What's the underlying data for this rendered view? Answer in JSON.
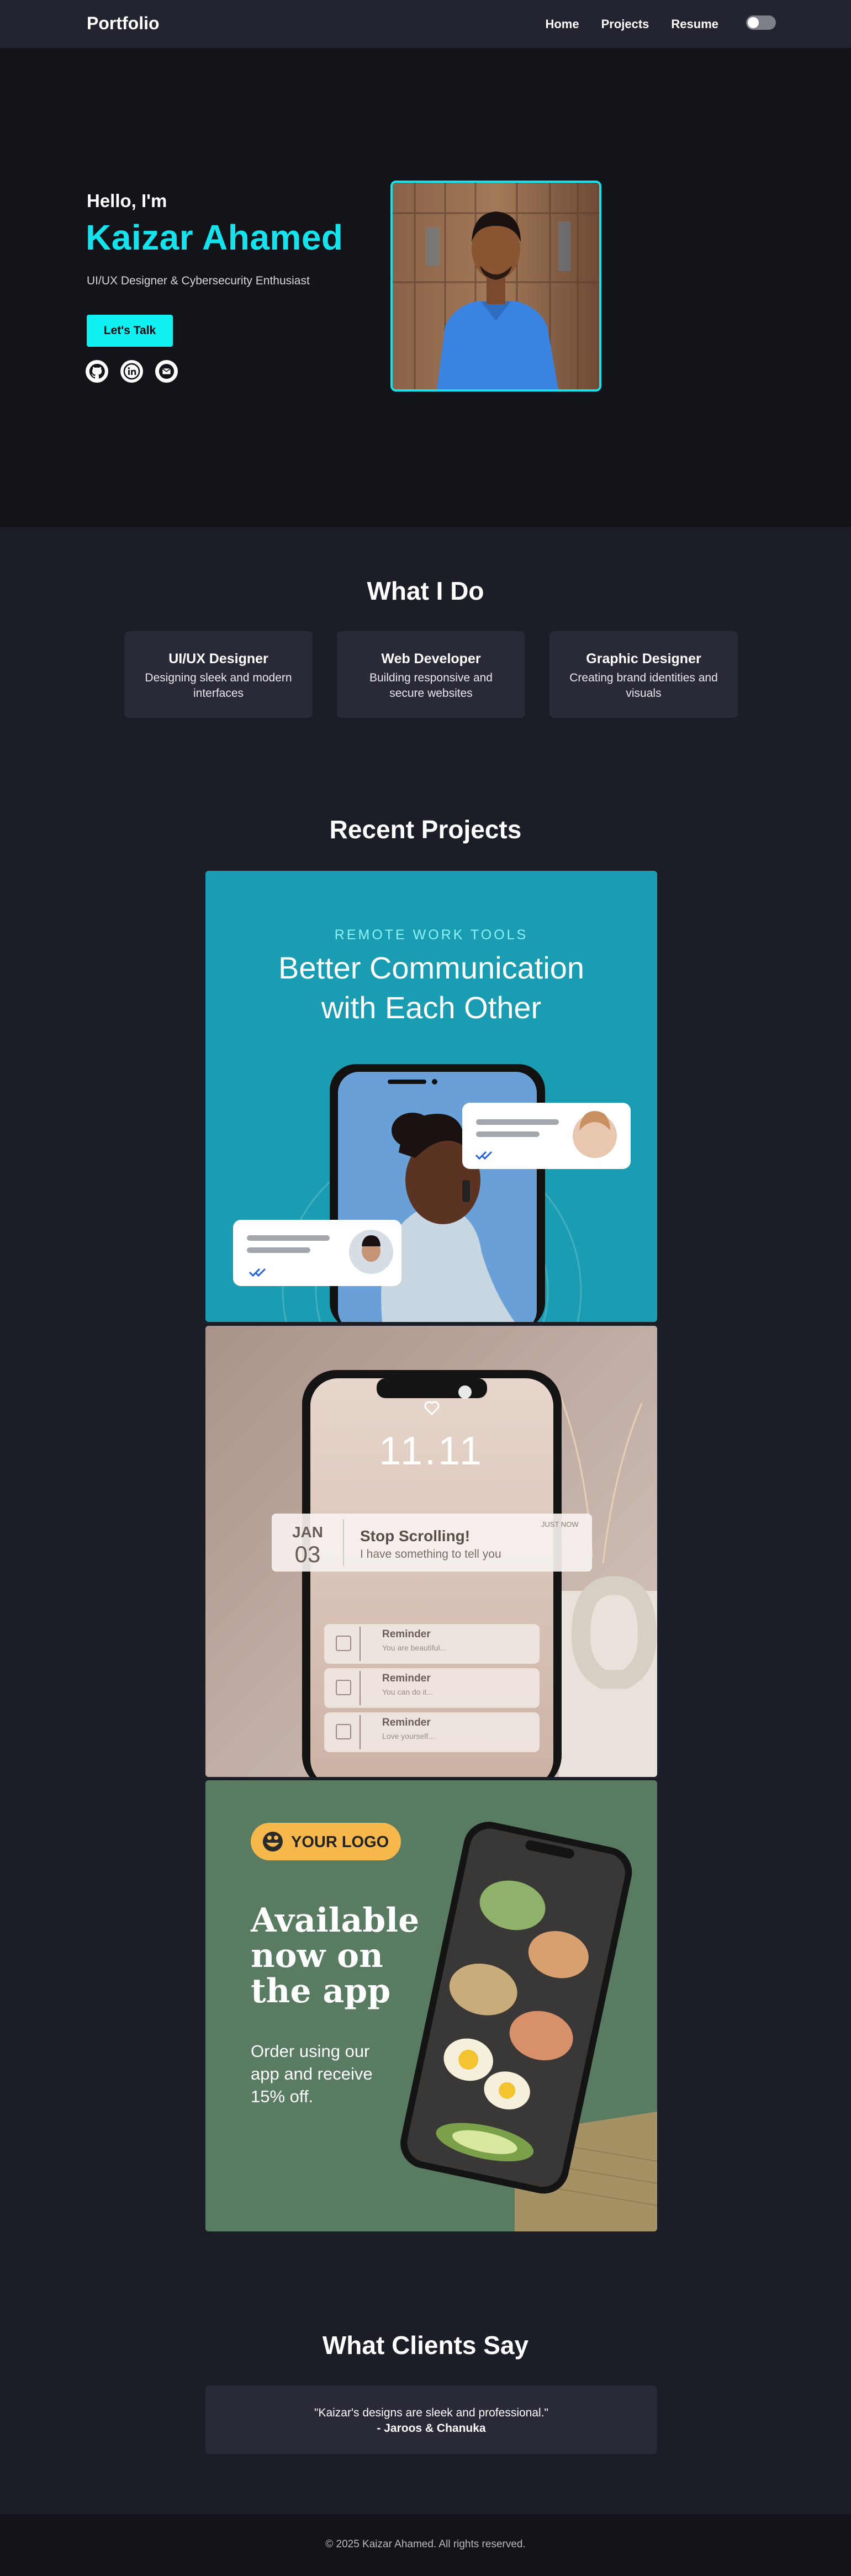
{
  "nav": {
    "brand": "Portfolio",
    "links": [
      "Home",
      "Projects",
      "Resume"
    ],
    "theme_toggle": "off"
  },
  "hero": {
    "greeting": "Hello, I'm",
    "name": "Kaizar Ahamed",
    "tagline": "UI/UX Designer & Cybersecurity Enthusiast",
    "cta_label": "Let's Talk",
    "socials": [
      "github-icon",
      "linkedin-icon",
      "email-icon"
    ]
  },
  "services": {
    "title": "What I Do",
    "items": [
      {
        "title": "UI/UX Designer",
        "desc": "Designing sleek and modern interfaces"
      },
      {
        "title": "Web Developer",
        "desc": "Building responsive and secure websites"
      },
      {
        "title": "Graphic Designer",
        "desc": "Creating brand identities and visuals"
      }
    ]
  },
  "projects": {
    "title": "Recent Projects",
    "p1": {
      "eyebrow": "REMOTE WORK TOOLS",
      "headline_1": "Better Communication",
      "headline_2": "with Each Other"
    },
    "p2": {
      "time": "11.11",
      "month": "JAN",
      "day": "03",
      "notif_title": "Stop Scrolling!",
      "notif_body": "I have something to tell you",
      "notif_time": "JUST NOW",
      "reminders": [
        {
          "title": "Reminder",
          "body": "You are beautiful..."
        },
        {
          "title": "Reminder",
          "body": "You can do it..."
        },
        {
          "title": "Reminder",
          "body": "Love yourself..."
        }
      ]
    },
    "p3": {
      "logo": "YOUR LOGO",
      "headline_1": "Available",
      "headline_2": "now on",
      "headline_3": "the app",
      "body_1": "Order using our",
      "body_2": "app and receive",
      "body_3": "15% off."
    }
  },
  "testimonials": {
    "title": "What Clients Say",
    "quote": "\"Kaizar's designs are sleek and professional.\"",
    "author": "- Jaroos & Chanuka"
  },
  "footer": {
    "text": "© 2025 Kaizar Ahamed. All rights reserved."
  },
  "colors": {
    "accent": "#14e3ee",
    "bg": "#1c1e27",
    "card": "#282a38",
    "hero_bg": "#131419"
  }
}
